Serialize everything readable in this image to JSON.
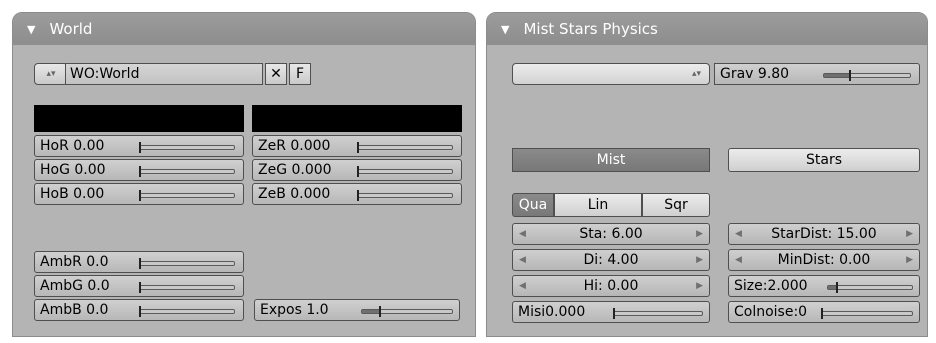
{
  "world_panel": {
    "title": "World",
    "world_name": "WO:World",
    "unlink_label": "✕",
    "fake_user_label": "F",
    "horizon": [
      {
        "label": "HoR 0.00",
        "value": 0.0
      },
      {
        "label": "HoG 0.00",
        "value": 0.0
      },
      {
        "label": "HoB 0.00",
        "value": 0.0
      }
    ],
    "zenith": [
      {
        "label": "ZeR 0.000",
        "value": 0.0
      },
      {
        "label": "ZeG 0.000",
        "value": 0.0
      },
      {
        "label": "ZeB 0.000",
        "value": 0.0
      }
    ],
    "ambient": [
      {
        "label": "AmbR 0.0",
        "value": 0.0
      },
      {
        "label": "AmbG 0.0",
        "value": 0.0
      },
      {
        "label": "AmbB 0.0",
        "value": 0.0
      }
    ],
    "exposure": {
      "label": "Expos 1.0",
      "value": 0.2
    },
    "horizon_color": "#000000",
    "zenith_color": "#000000"
  },
  "mist_panel": {
    "title": "Mist Stars Physics",
    "physics_dropdown": "",
    "gravity": {
      "label": "Grav 9.80",
      "value": 0.3
    },
    "mist_label": "Mist",
    "stars_label": "Stars",
    "falloff": [
      {
        "label": "Qua",
        "active": true
      },
      {
        "label": "Lin",
        "active": false
      },
      {
        "label": "Sqr",
        "active": false
      }
    ],
    "mist_fields": [
      {
        "label": "Sta: 6.00"
      },
      {
        "label": "Di: 4.00"
      },
      {
        "label": "Hi: 0.00"
      }
    ],
    "misi": {
      "label": "Misi0.000",
      "value": 0.0
    },
    "star_fields": [
      {
        "label": "StarDist: 15.00"
      },
      {
        "label": "MinDist: 0.00"
      }
    ],
    "size": {
      "label": "Size:2.000",
      "value": 0.1
    },
    "colnoise": {
      "label": "Colnoise:0",
      "value": 0.0
    }
  }
}
